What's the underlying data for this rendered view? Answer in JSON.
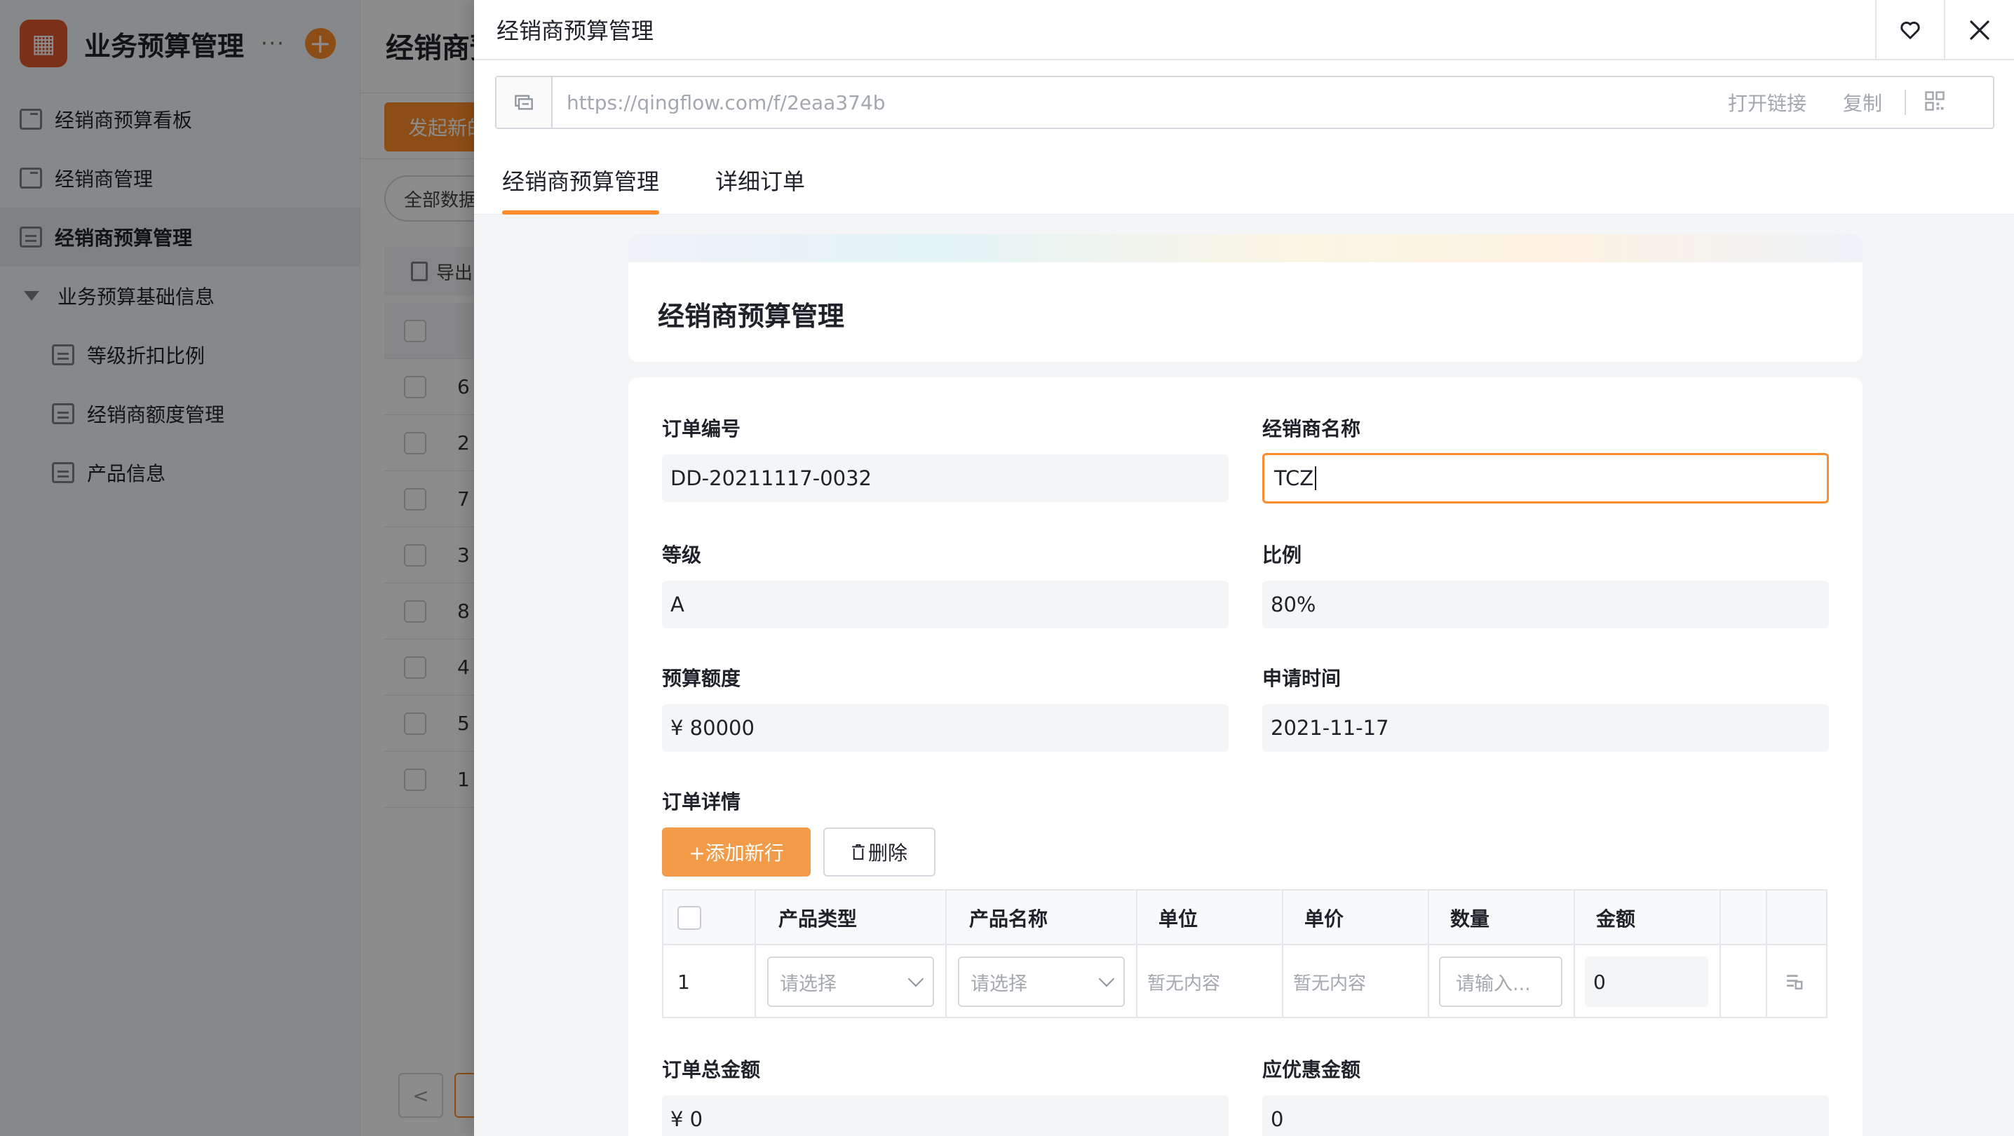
{
  "app": {
    "title": "业务预算管理",
    "more": "···",
    "plus": "+"
  },
  "sidebar": {
    "items": [
      {
        "label": "经销商预算看板"
      },
      {
        "label": "经销商管理"
      },
      {
        "label": "经销商预算管理"
      },
      {
        "label": "业务预算基础信息"
      },
      {
        "label": "等级折扣比例"
      },
      {
        "label": "经销商额度管理"
      },
      {
        "label": "产品信息"
      }
    ]
  },
  "background": {
    "title": "经销商预",
    "new_button": "发起新的",
    "filter": "全部数据",
    "export": "导出",
    "row_first_chars": [
      "6",
      "2",
      "7",
      "3",
      "8",
      "4",
      "5",
      "1"
    ],
    "pager_prev": "<"
  },
  "drawer": {
    "title": "经销商预算管理",
    "url": "https://qingflow.com/f/2eaa374b",
    "open_link": "打开链接",
    "copy": "复制",
    "tabs": [
      {
        "label": "经销商预算管理"
      },
      {
        "label": "详细订单"
      }
    ]
  },
  "form": {
    "title": "经销商预算管理",
    "order_no": {
      "label": "订单编号",
      "value": "DD-20211117-0032"
    },
    "dealer_name": {
      "label": "经销商名称",
      "value": "TCZ"
    },
    "level": {
      "label": "等级",
      "value": "A"
    },
    "ratio": {
      "label": "比例",
      "value": "80%"
    },
    "budget": {
      "label": "预算额度",
      "value": "¥ 80000"
    },
    "apply_time": {
      "label": "申请时间",
      "value": "2021-11-17"
    },
    "details": {
      "label": "订单详情",
      "add_row": "+添加新行",
      "delete": "删除",
      "columns": [
        "产品类型",
        "产品名称",
        "单位",
        "单价",
        "数量",
        "金额"
      ],
      "rows": [
        {
          "index": "1",
          "product_type_placeholder": "请选择",
          "product_name_placeholder": "请选择",
          "unit": "暂无内容",
          "price": "暂无内容",
          "qty_placeholder": "请输入...",
          "amount": "0"
        }
      ]
    },
    "total": {
      "label": "订单总金额",
      "value": "¥ 0"
    },
    "discount": {
      "label": "应优惠金额",
      "value": "0"
    }
  },
  "colors": {
    "accent": "#ff8c2b",
    "accent_soft": "#f29b48"
  }
}
